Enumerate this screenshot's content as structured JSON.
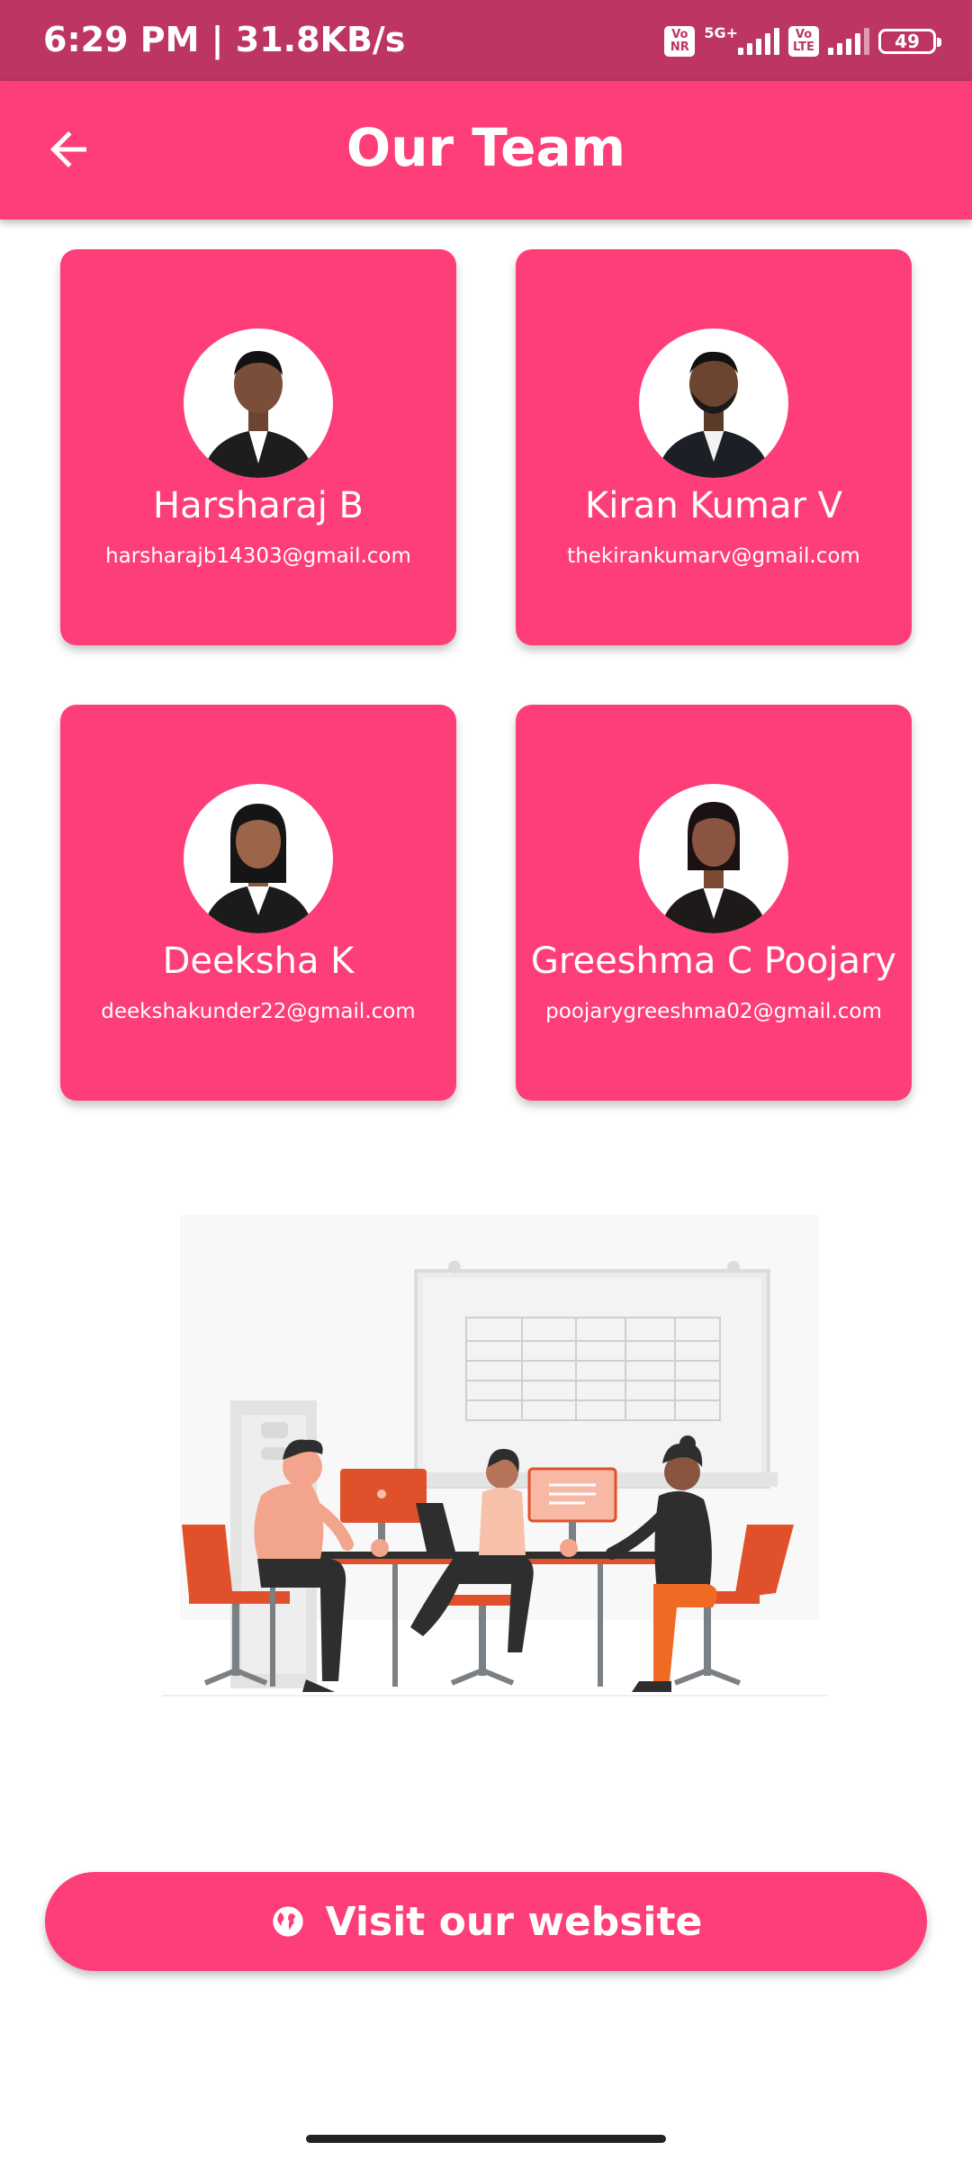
{
  "status_bar": {
    "time": "6:29 PM | 31.8KB/s",
    "network_1": "5G+",
    "battery": "49",
    "badges": [
      [
        "Vo",
        "NR"
      ],
      [
        "Vo",
        "LTE"
      ]
    ]
  },
  "app_bar": {
    "title": "Our Team",
    "back_icon": "arrow-left-icon"
  },
  "team": [
    {
      "name": "Harsharaj B",
      "email": "harsharajb14303@gmail.com"
    },
    {
      "name": "Kiran Kumar V",
      "email": "thekirankumarv@gmail.com"
    },
    {
      "name": "Deeksha K",
      "email": "deekshakunder22@gmail.com"
    },
    {
      "name": "Greeshma C Poojary",
      "email": "poojarygreeshma02@gmail.com"
    }
  ],
  "website_button": {
    "label": "Visit our website",
    "icon": "globe-icon"
  },
  "colors": {
    "accent": "#fd3e79",
    "status_bar": "#bd3562",
    "illustration_orange": "#e0512b"
  }
}
